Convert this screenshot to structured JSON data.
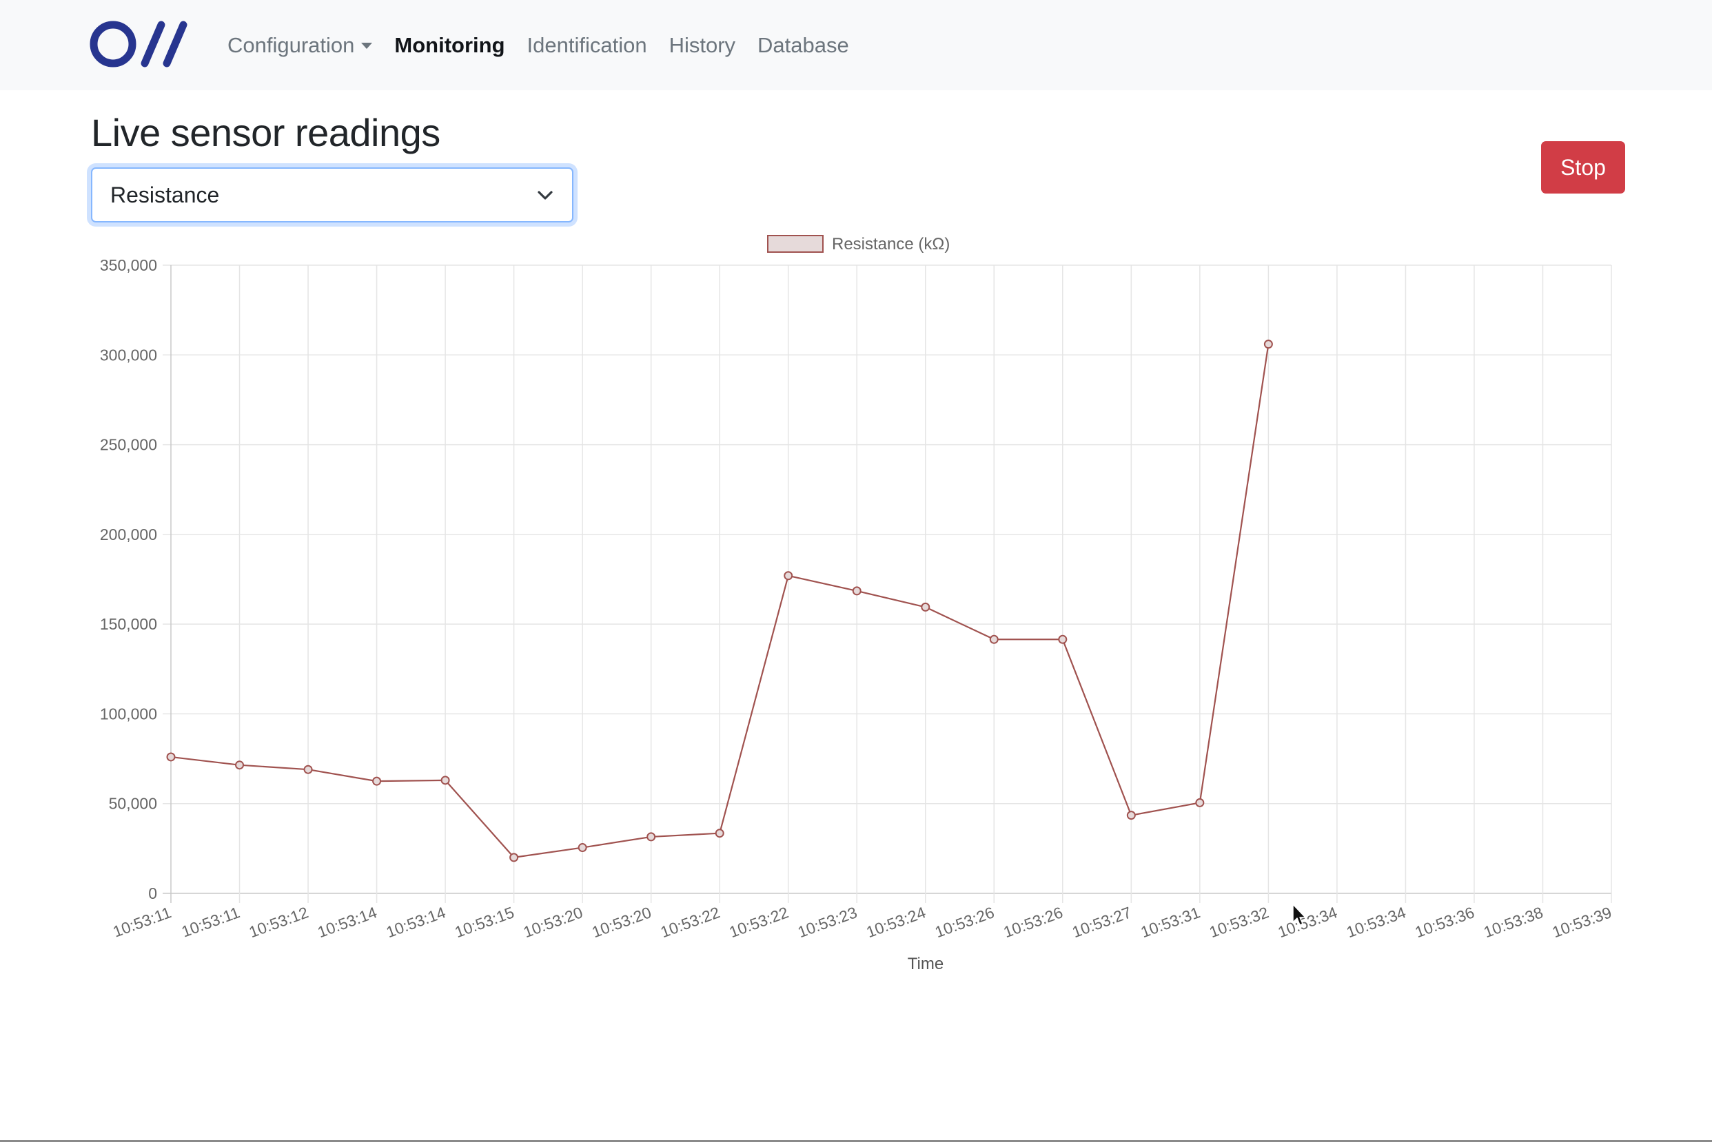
{
  "navbar": {
    "logo_icon": "openmos-logo-icon",
    "items": [
      {
        "label": "Configuration",
        "dropdown": true,
        "active": false
      },
      {
        "label": "Monitoring",
        "dropdown": false,
        "active": true
      },
      {
        "label": "Identification",
        "dropdown": false,
        "active": false
      },
      {
        "label": "History",
        "dropdown": false,
        "active": false
      },
      {
        "label": "Database",
        "dropdown": false,
        "active": false
      }
    ]
  },
  "page": {
    "title": "Live sensor readings",
    "stop_label": "Stop"
  },
  "sensor_select": {
    "value": "Resistance",
    "icon": "chevron-down-icon"
  },
  "colors": {
    "brand": "#27358f",
    "stop_button": "#d13d46",
    "series_line": "#a0524f",
    "legend_fill": "#e6dada"
  },
  "chart_data": {
    "type": "line",
    "legend": {
      "position": "top",
      "entries": [
        "Resistance (kΩ)"
      ]
    },
    "xlabel": "Time",
    "ylabel": "",
    "ylim": [
      0,
      350000
    ],
    "yticks": [
      0,
      50000,
      100000,
      150000,
      200000,
      250000,
      300000,
      350000
    ],
    "ytick_labels": [
      "0",
      "50,000",
      "100,000",
      "150,000",
      "200,000",
      "250,000",
      "300,000",
      "350,000"
    ],
    "grid": true,
    "x": [
      "10:53:11",
      "10:53:11",
      "10:53:12",
      "10:53:14",
      "10:53:14",
      "10:53:15",
      "10:53:20",
      "10:53:20",
      "10:53:22",
      "10:53:22",
      "10:53:23",
      "10:53:24",
      "10:53:26",
      "10:53:26",
      "10:53:27",
      "10:53:31",
      "10:53:32",
      "10:53:34",
      "10:53:34",
      "10:53:36",
      "10:53:38",
      "10:53:39"
    ],
    "series": [
      {
        "name": "Resistance (kΩ)",
        "values": [
          76000,
          71500,
          69000,
          62500,
          63000,
          20000,
          25500,
          31500,
          33500,
          177000,
          168500,
          159500,
          141500,
          141500,
          43500,
          50500,
          306000,
          null,
          null,
          null,
          null,
          null
        ]
      }
    ]
  }
}
